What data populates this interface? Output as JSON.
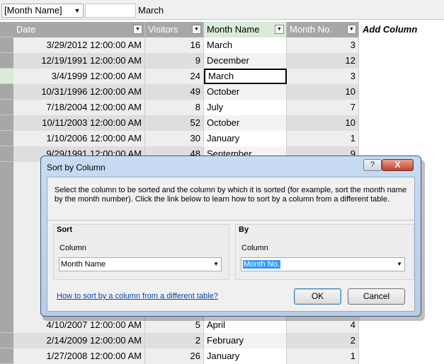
{
  "formula_bar": {
    "name_box": "[Month Name]",
    "formula": "March"
  },
  "table": {
    "columns": [
      "Date",
      "Visitors",
      "Month Name",
      "Month No.",
      "Add Column"
    ],
    "rows": [
      {
        "date": "3/29/2012 12:00:00 AM",
        "visitors": "16",
        "month": "March",
        "month_no": "3"
      },
      {
        "date": "12/19/1991 12:00:00 AM",
        "visitors": "9",
        "month": "December",
        "month_no": "12"
      },
      {
        "date": "3/4/1999 12:00:00 AM",
        "visitors": "24",
        "month": "March",
        "month_no": "3"
      },
      {
        "date": "10/31/1996 12:00:00 AM",
        "visitors": "49",
        "month": "October",
        "month_no": "10"
      },
      {
        "date": "7/18/2004 12:00:00 AM",
        "visitors": "8",
        "month": "July",
        "month_no": "7"
      },
      {
        "date": "10/11/2003 12:00:00 AM",
        "visitors": "52",
        "month": "October",
        "month_no": "10"
      },
      {
        "date": "1/10/2006 12:00:00 AM",
        "visitors": "30",
        "month": "January",
        "month_no": "1"
      },
      {
        "date": "9/29/1991 12:00:00 AM",
        "visitors": "48",
        "month": "September",
        "month_no": "9"
      }
    ],
    "bottom_rows": [
      {
        "date": "4/10/2007 12:00:00 AM",
        "visitors": "5",
        "month": "April",
        "month_no": "4"
      },
      {
        "date": "2/14/2009 12:00:00 AM",
        "visitors": "2",
        "month": "February",
        "month_no": "2"
      },
      {
        "date": "1/27/2008 12:00:00 AM",
        "visitors": "26",
        "month": "January",
        "month_no": "1"
      }
    ]
  },
  "dialog": {
    "title": "Sort by Column",
    "help": "?",
    "close": "X",
    "description": "Select the column to be sorted and the column by which it is sorted (for example, sort the month name by the month number). Click the link below to learn how to sort by a column from a different table.",
    "sort": {
      "title": "Sort",
      "label": "Column",
      "value": "Month Name"
    },
    "by": {
      "title": "By",
      "label": "Column",
      "value": "Month No."
    },
    "link": "How to sort by a column from a different table?",
    "ok": "OK",
    "cancel": "Cancel"
  },
  "colors": {
    "header_bg": "#a7a7a7",
    "selected_header_bg": "#d9ead9",
    "dialog_frame": "#b7cde6",
    "link": "#0645ad"
  },
  "icons": [
    "dropdown-arrow-icon",
    "filter-dropdown-icon",
    "help-icon",
    "close-icon"
  ]
}
